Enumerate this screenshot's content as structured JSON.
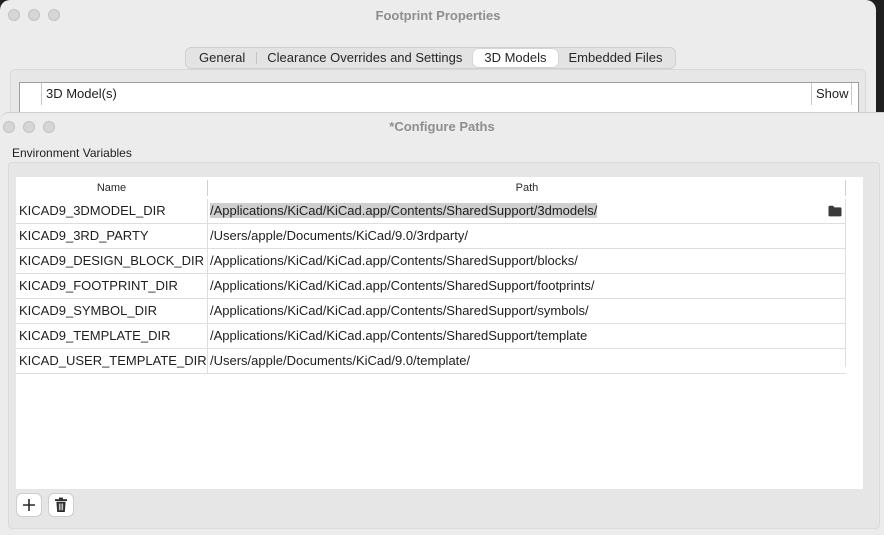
{
  "back_window": {
    "title": "Footprint Properties",
    "tabs": [
      {
        "label": "General",
        "active": false
      },
      {
        "label": "Clearance Overrides and Settings",
        "active": false
      },
      {
        "label": "3D Models",
        "active": true
      },
      {
        "label": "Embedded Files",
        "active": false
      }
    ],
    "models_grid": {
      "col_models": "3D Model(s)",
      "col_show": "Show"
    }
  },
  "front_window": {
    "title": "*Configure Paths",
    "section_label": "Environment Variables",
    "columns": {
      "name": "Name",
      "path": "Path"
    },
    "rows": [
      {
        "name": "KICAD9_3DMODEL_DIR",
        "path": "/Applications/KiCad/KiCad.app/Contents/SharedSupport/3dmodels/",
        "selected": true
      },
      {
        "name": "KICAD9_3RD_PARTY",
        "path": "/Users/apple/Documents/KiCad/9.0/3rdparty/"
      },
      {
        "name": "KICAD9_DESIGN_BLOCK_DIR",
        "path": "/Applications/KiCad/KiCad.app/Contents/SharedSupport/blocks/"
      },
      {
        "name": "KICAD9_FOOTPRINT_DIR",
        "path": "/Applications/KiCad/KiCad.app/Contents/SharedSupport/footprints/"
      },
      {
        "name": "KICAD9_SYMBOL_DIR",
        "path": "/Applications/KiCad/KiCad.app/Contents/SharedSupport/symbols/"
      },
      {
        "name": "KICAD9_TEMPLATE_DIR",
        "path": "/Applications/KiCad/KiCad.app/Contents/SharedSupport/template"
      },
      {
        "name": "KICAD_USER_TEMPLATE_DIR",
        "path": "/Users/apple/Documents/KiCad/9.0/template/"
      }
    ],
    "buttons": {
      "add_icon": "plus-icon",
      "delete_icon": "trash-icon",
      "browse_icon": "folder-icon"
    }
  },
  "colors": {
    "selection": "#cfcfcf",
    "window_bg": "#ececec",
    "desktop": "#1f1f22"
  }
}
